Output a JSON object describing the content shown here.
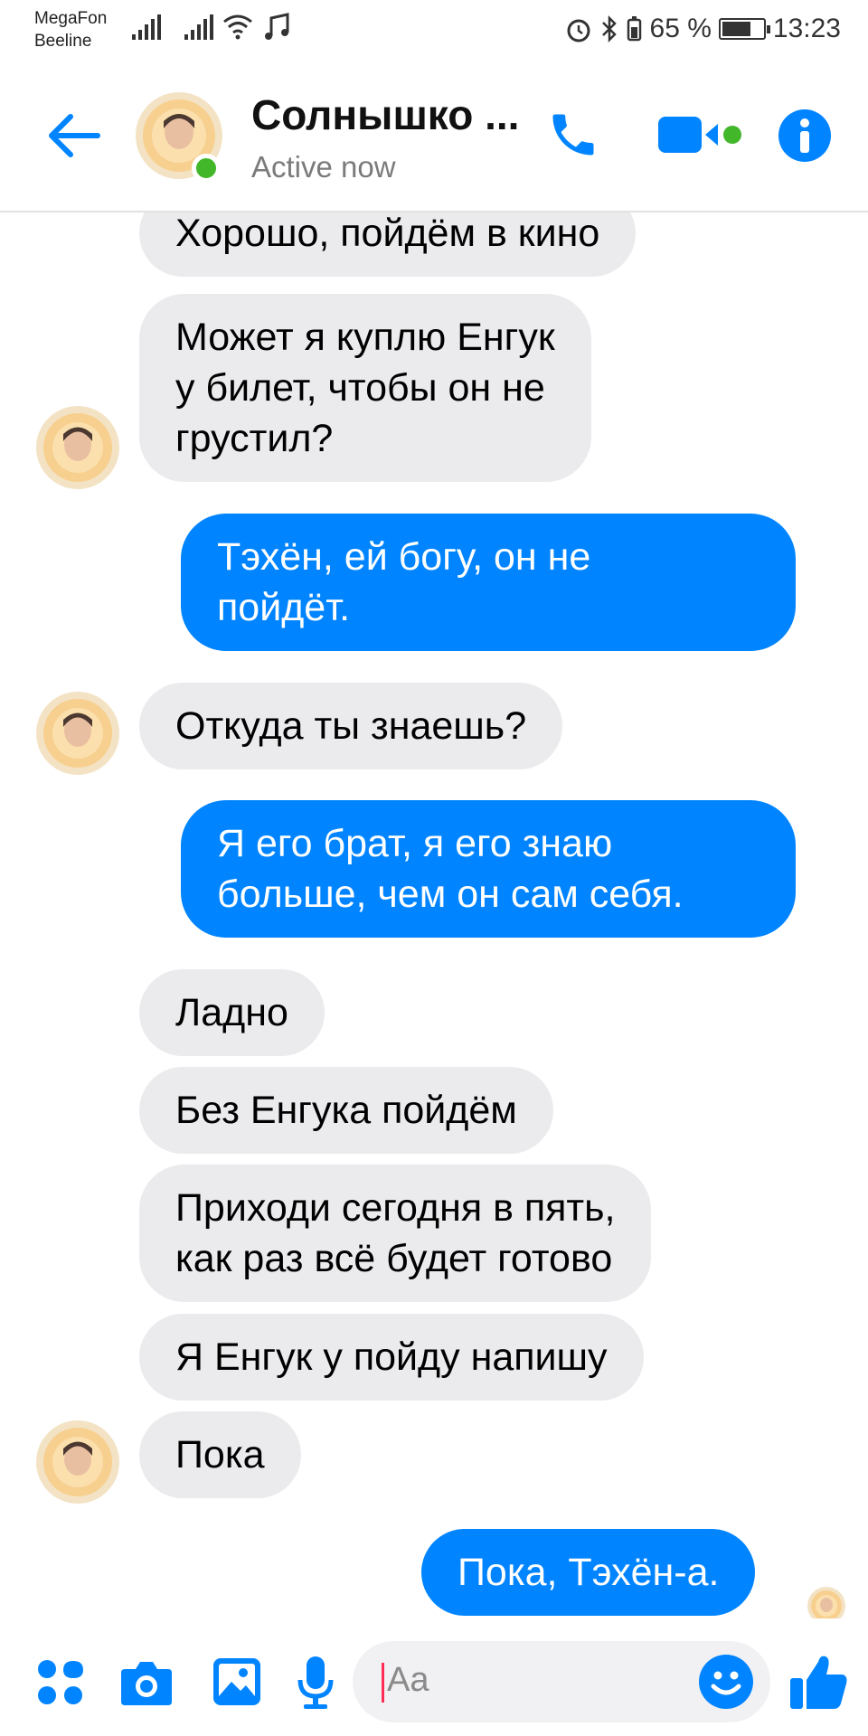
{
  "status_bar": {
    "carrier_1": "MegaFon",
    "carrier_2": "Beeline",
    "battery_text": "65 %",
    "battery_level": 0.65,
    "time": "13:23"
  },
  "header": {
    "contact_name": "Солнышко ...",
    "contact_status": "Active now"
  },
  "messages": [
    {
      "side": "in",
      "lines": [
        "Хорошо, пойдём в кино"
      ]
    },
    {
      "side": "in",
      "lines": [
        "Может я куплю Енгук",
        "у билет, чтобы он не",
        "грустил?"
      ]
    },
    {
      "side": "out",
      "lines": [
        "Тэхён, ей богу, он не",
        "пойдёт."
      ]
    },
    {
      "side": "in",
      "lines": [
        "Откуда ты знаешь?"
      ]
    },
    {
      "side": "out",
      "lines": [
        "Я его брат, я его знаю",
        "больше, чем он сам себя."
      ]
    },
    {
      "side": "in",
      "lines": [
        "Ладно"
      ]
    },
    {
      "side": "in",
      "lines": [
        "Без Енгука пойдём"
      ]
    },
    {
      "side": "in",
      "lines": [
        "Приходи сегодня в пять,",
        "как раз всё будет готово"
      ]
    },
    {
      "side": "in",
      "lines": [
        "Я Енгук у пойду напишу"
      ]
    },
    {
      "side": "in",
      "lines": [
        "Пока"
      ]
    },
    {
      "side": "out",
      "lines": [
        "Пока, Тэхён-а."
      ]
    }
  ],
  "composer": {
    "placeholder": "Aa"
  },
  "colors": {
    "accent": "#0084ff",
    "incoming_bubble": "#ebebee",
    "online": "#42b72a"
  },
  "icons": {
    "back": "arrow-left-icon",
    "call": "phone-icon",
    "video": "video-camera-icon",
    "info": "info-icon",
    "apps": "four-dots-icon",
    "camera": "camera-icon",
    "gallery": "image-icon",
    "voice": "microphone-icon",
    "emoji": "smiley-icon",
    "like": "thumbs-up-icon"
  }
}
